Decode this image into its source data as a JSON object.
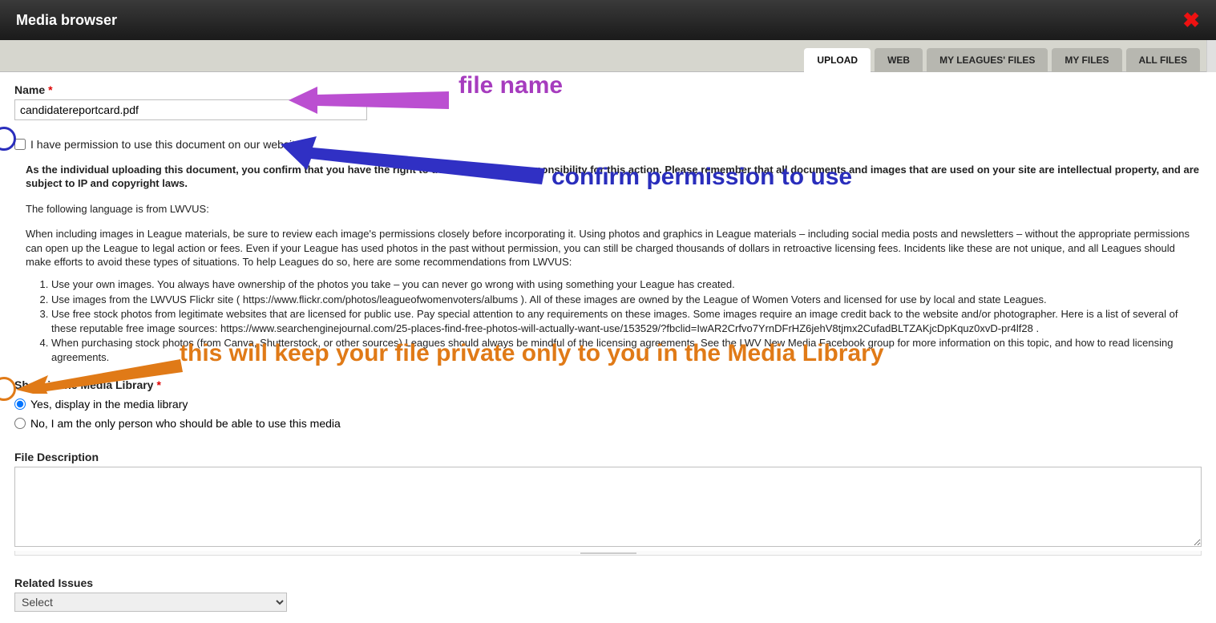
{
  "header": {
    "title": "Media browser"
  },
  "tabs": {
    "items": [
      {
        "label": "UPLOAD",
        "active": true
      },
      {
        "label": "WEB"
      },
      {
        "label": "MY LEAGUES' FILES"
      },
      {
        "label": "MY FILES"
      },
      {
        "label": "ALL FILES"
      }
    ]
  },
  "form": {
    "name_label": "Name",
    "name_value": "candidatereportcard.pdf",
    "perm_label": "I have permission to use this document on our website",
    "perm_checked": false,
    "confirm_bold": "As the individual uploading this document, you confirm that you have the right to do so and accept responsibility for this action. Please remember that all documents and images that are used on your site are intellectual property, and are subject to IP and copyright laws.",
    "lwvus_intro": "The following language is from LWVUS:",
    "lwvus_para": "When including images in League materials, be sure to review each image's permissions closely before incorporating it. Using photos and graphics in League materials – including social media posts and newsletters – without the appropriate permissions can open up the League to legal action or fees. Even if your League has used photos in the past without permission, you can still be charged thousands of dollars in retroactive licensing fees. Incidents like these are not unique, and all Leagues should make efforts to avoid these types of situations. To help Leagues do so, here are some recommendations from LWVUS:",
    "recs": [
      "Use your own images. You always have ownership of the photos you take – you can never go wrong with using something your League has created.",
      "Use images from the LWVUS Flickr site ( https://www.flickr.com/photos/leagueofwomenvoters/albums ). All of these images are owned by the League of Women Voters and licensed for use by local and state Leagues.",
      "Use free stock photos from legitimate websites that are licensed for public use. Pay special attention to any requirements on these images. Some images require an image credit back to the website and/or photographer. Here is a list of several of these reputable free image sources: https://www.searchenginejournal.com/25-places-find-free-photos-will-actually-want-use/153529/?fbclid=IwAR2Crfvo7YrnDFrHZ6jehV8tjmx2CufadBLTZAKjcDpKquz0xvD-pr4lf28 .",
      "When purchasing stock photos (from Canva, Shutterstock, or other sources) Leagues should always be mindful of the licensing agreements. See the LWV New Media Facebook group for more information on this topic, and how to read licensing agreements."
    ],
    "show_label": "Show in the Media Library",
    "radios": {
      "yes": "Yes, display in the media library",
      "no": "No, I am the only person who should be able to use this media",
      "selected": "yes"
    },
    "desc_label": "File Description",
    "related_label": "Related Issues",
    "related_placeholder": "Select"
  },
  "annotations": {
    "file_name": "file name",
    "confirm_perm": "confirm permission to use",
    "private_note": "this will keep your file private only to you in the Media Library"
  }
}
